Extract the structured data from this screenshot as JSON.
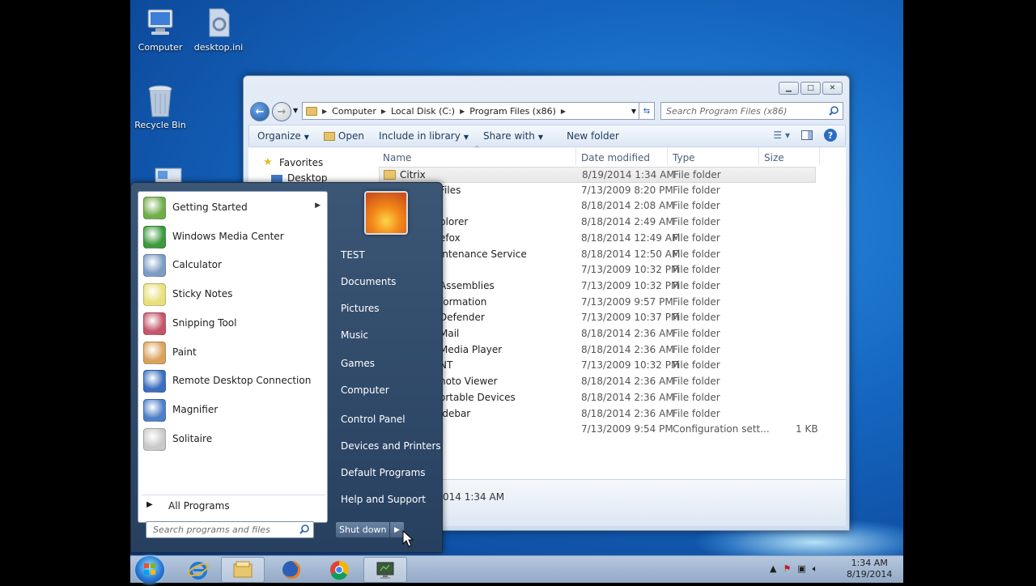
{
  "desktop": {
    "icons": [
      {
        "label": "Computer"
      },
      {
        "label": "desktop.ini"
      },
      {
        "label": "Recycle Bin"
      }
    ]
  },
  "explorer": {
    "address": {
      "parts": [
        "Computer",
        "Local Disk (C:)",
        "Program Files (x86)"
      ]
    },
    "search_placeholder": "Search Program Files (x86)",
    "toolbar": {
      "organize": "Organize",
      "open": "Open",
      "include": "Include in library",
      "share": "Share with",
      "newfolder": "New folder"
    },
    "nav": {
      "favorites": "Favorites",
      "desktop": "Desktop"
    },
    "columns": {
      "name": "Name",
      "date": "Date modified",
      "type": "Type",
      "size": "Size"
    },
    "rows": [
      {
        "name": "Citrix",
        "date": "8/19/2014 1:34 AM",
        "type": "File folder",
        "size": ""
      },
      {
        "name": "Files",
        "date": "7/13/2009 8:20 PM",
        "type": "File folder",
        "size": ""
      },
      {
        "name": "",
        "date": "8/18/2014 2:08 AM",
        "type": "File folder",
        "size": ""
      },
      {
        "name": "plorer",
        "date": "8/18/2014 2:49 AM",
        "type": "File folder",
        "size": ""
      },
      {
        "name": "efox",
        "date": "8/18/2014 12:49 AM",
        "type": "File folder",
        "size": ""
      },
      {
        "name": "intenance Service",
        "date": "8/18/2014 12:50 AM",
        "type": "File folder",
        "size": ""
      },
      {
        "name": "",
        "date": "7/13/2009 10:32 PM",
        "type": "File folder",
        "size": ""
      },
      {
        "name": "Assemblies",
        "date": "7/13/2009 10:32 PM",
        "type": "File folder",
        "size": ""
      },
      {
        "name": "formation",
        "date": "7/13/2009 9:57 PM",
        "type": "File folder",
        "size": ""
      },
      {
        "name": "Defender",
        "date": "7/13/2009 10:37 PM",
        "type": "File folder",
        "size": ""
      },
      {
        "name": "Mail",
        "date": "8/18/2014 2:36 AM",
        "type": "File folder",
        "size": ""
      },
      {
        "name": "Media Player",
        "date": "8/18/2014 2:36 AM",
        "type": "File folder",
        "size": ""
      },
      {
        "name": "NT",
        "date": "7/13/2009 10:32 PM",
        "type": "File folder",
        "size": ""
      },
      {
        "name": "hoto Viewer",
        "date": "8/18/2014 2:36 AM",
        "type": "File folder",
        "size": ""
      },
      {
        "name": "ortable Devices",
        "date": "8/18/2014 2:36 AM",
        "type": "File folder",
        "size": ""
      },
      {
        "name": "idebar",
        "date": "8/18/2014 2:36 AM",
        "type": "File folder",
        "size": ""
      },
      {
        "name": "",
        "date": "7/13/2009 9:54 PM",
        "type": "Configuration sett...",
        "size": "1 KB"
      }
    ],
    "details": {
      "date": "014 1:34 AM"
    }
  },
  "startmenu": {
    "programs": [
      {
        "label": "Getting Started",
        "icon": "getting-started-icon",
        "color": "#6fae4a",
        "has_arrow": true
      },
      {
        "label": "Windows Media Center",
        "icon": "media-center-icon",
        "color": "#3c9a3c",
        "has_arrow": false
      },
      {
        "label": "Calculator",
        "icon": "calculator-icon",
        "color": "#7b9cc4",
        "has_arrow": false
      },
      {
        "label": "Sticky Notes",
        "icon": "sticky-notes-icon",
        "color": "#e8e07a",
        "has_arrow": false
      },
      {
        "label": "Snipping Tool",
        "icon": "snipping-tool-icon",
        "color": "#c4566a",
        "has_arrow": false
      },
      {
        "label": "Paint",
        "icon": "paint-icon",
        "color": "#d9a35c",
        "has_arrow": false
      },
      {
        "label": "Remote Desktop Connection",
        "icon": "remote-desktop-icon",
        "color": "#3a6fbf",
        "has_arrow": false
      },
      {
        "label": "Magnifier",
        "icon": "magnifier-icon",
        "color": "#4f7fc8",
        "has_arrow": false
      },
      {
        "label": "Solitaire",
        "icon": "solitaire-icon",
        "color": "#c9c9c9",
        "has_arrow": false
      }
    ],
    "all_programs": "All Programs",
    "search_placeholder": "Search programs and files",
    "right_links": [
      "TEST",
      "Documents",
      "Pictures",
      "Music",
      "Games",
      "Computer",
      "Control Panel",
      "Devices and Printers",
      "Default Programs",
      "Help and Support"
    ],
    "shutdown": "Shut down"
  },
  "taskbar": {
    "clock": {
      "time": "1:34 AM",
      "date": "8/19/2014"
    }
  }
}
